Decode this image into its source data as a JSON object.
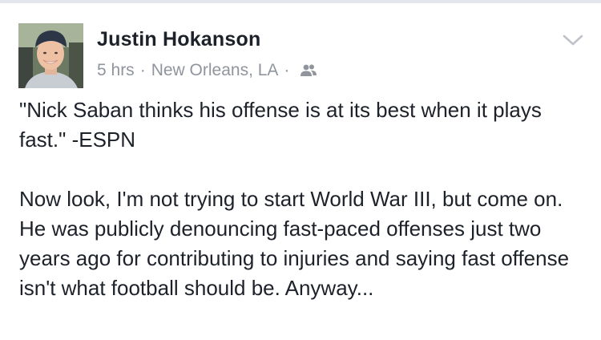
{
  "post": {
    "author_name": "Justin Hokanson",
    "timestamp": "5 hrs",
    "separator": "·",
    "location": "New Orleans, LA",
    "audience_icon": "friends-icon",
    "menu_icon": "chevron-down-icon",
    "paragraphs": [
      "\"Nick Saban thinks his offense is at its best when it plays fast.\" -ESPN",
      "Now look, I'm not trying to start World War III, but come on. He was publicly denouncing fast-paced offenses just two years ago for contributing to injuries and saying fast offense isn't what football should be. Anyway..."
    ]
  },
  "colors": {
    "text_primary": "#1d2129",
    "text_secondary": "#90949c",
    "divider": "#e4e6eb"
  }
}
